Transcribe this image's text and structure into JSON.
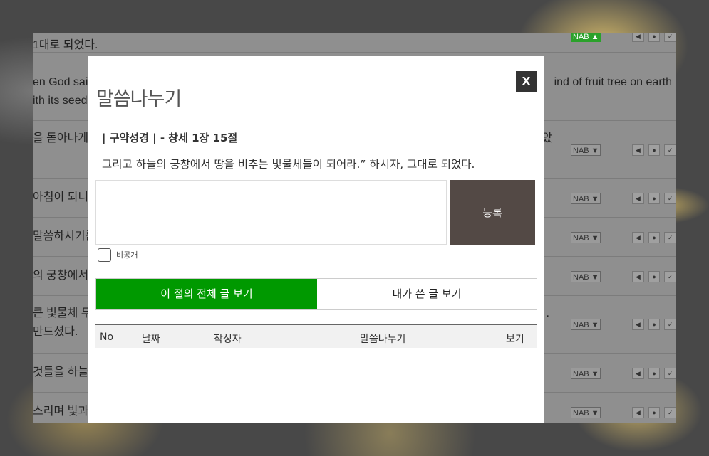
{
  "background": {
    "rows": [
      {
        "text": "1대로 되었다.",
        "version": "NAB ▲",
        "version_green": true,
        "right_text": ""
      },
      {
        "text": "en God sai",
        "text2": "ith its seed",
        "version": "",
        "version_green": false,
        "right_text": "ind of fruit tree on earth"
      },
      {
        "text": "을 돋아나게 하",
        "version": "NAB ▼",
        "version_green": false,
        "right_text": "았"
      },
      {
        "text": "아침이 되니 ",
        "version": "NAB ▼",
        "version_green": false,
        "right_text": ""
      },
      {
        "text": "말씀하시기를",
        "version": "NAB ▼",
        "version_green": false,
        "right_text": ""
      },
      {
        "text": "의 궁창에서 땅",
        "version": "NAB ▼",
        "version_green": false,
        "right_text": ""
      },
      {
        "text": "큰 빛물체 두",
        "text2": "만드셨다.",
        "version": "NAB ▼",
        "version_green": false,
        "right_text": "."
      },
      {
        "text": "것들을 하늘",
        "version": "NAB ▼",
        "version_green": false,
        "right_text": ""
      },
      {
        "text": "스리며 빛과 ",
        "version": "NAB ▼",
        "version_green": false,
        "right_text": ""
      }
    ]
  },
  "modal": {
    "close_label": "X",
    "title": "말씀나누기",
    "reference": "| 구약성경 | - 창세 1장 15절",
    "verse": "그리고 하늘의 궁창에서 땅을 비추는 빛물체들이 되어라.” 하시자, 그대로 되었다.",
    "comment_value": "",
    "submit_label": "등록",
    "private_label": "비공개",
    "tabs": [
      {
        "label": "이 절의 전체 글 보기",
        "active": true
      },
      {
        "label": "내가 쓴 글 보기",
        "active": false
      }
    ],
    "table_headers": [
      "No",
      "날짜",
      "작성자",
      "말씀나누기",
      "보기"
    ]
  },
  "colors": {
    "active_tab": "#009900",
    "submit_button": "#534945",
    "close_button": "#333333"
  }
}
